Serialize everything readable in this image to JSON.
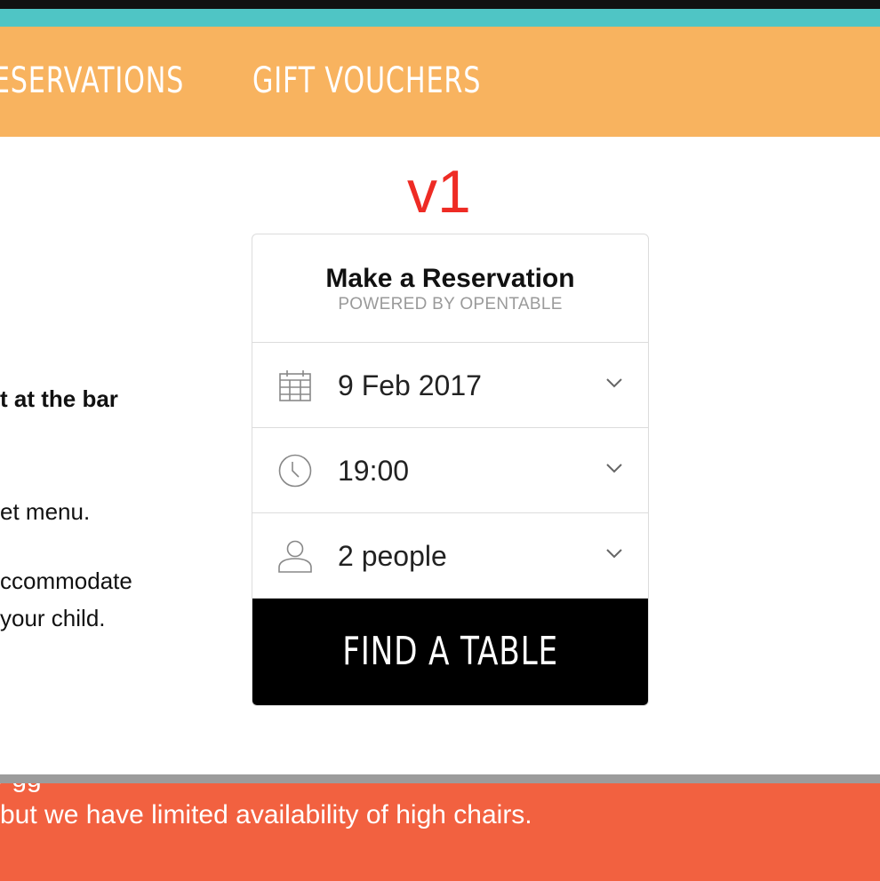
{
  "nav": {
    "items": [
      {
        "label": "RESERVATIONS"
      },
      {
        "label": "GIFT VOUCHERS"
      }
    ]
  },
  "version_label": "v1",
  "body_text": {
    "line1": "t at the bar",
    "line2": "et menu.",
    "line3": "ccommodate",
    "line4": "your child."
  },
  "widget": {
    "title": "Make a Reservation",
    "subtitle": "POWERED BY OPENTABLE",
    "date": {
      "value": "9 Feb 2017",
      "icon": "calendar-icon"
    },
    "time": {
      "value": "19:00",
      "icon": "clock-icon"
    },
    "party": {
      "value": "2 people",
      "icon": "person-icon"
    },
    "cta": "FIND A TABLE"
  },
  "footer": {
    "partial_line": "y                                 gg",
    "text": "but we have limited availability of high chairs."
  },
  "colors": {
    "teal": "#4fc5c5",
    "nav": "#f8b35f",
    "version": "#ee2b24",
    "footer": "#f26140",
    "cta": "#000000"
  }
}
